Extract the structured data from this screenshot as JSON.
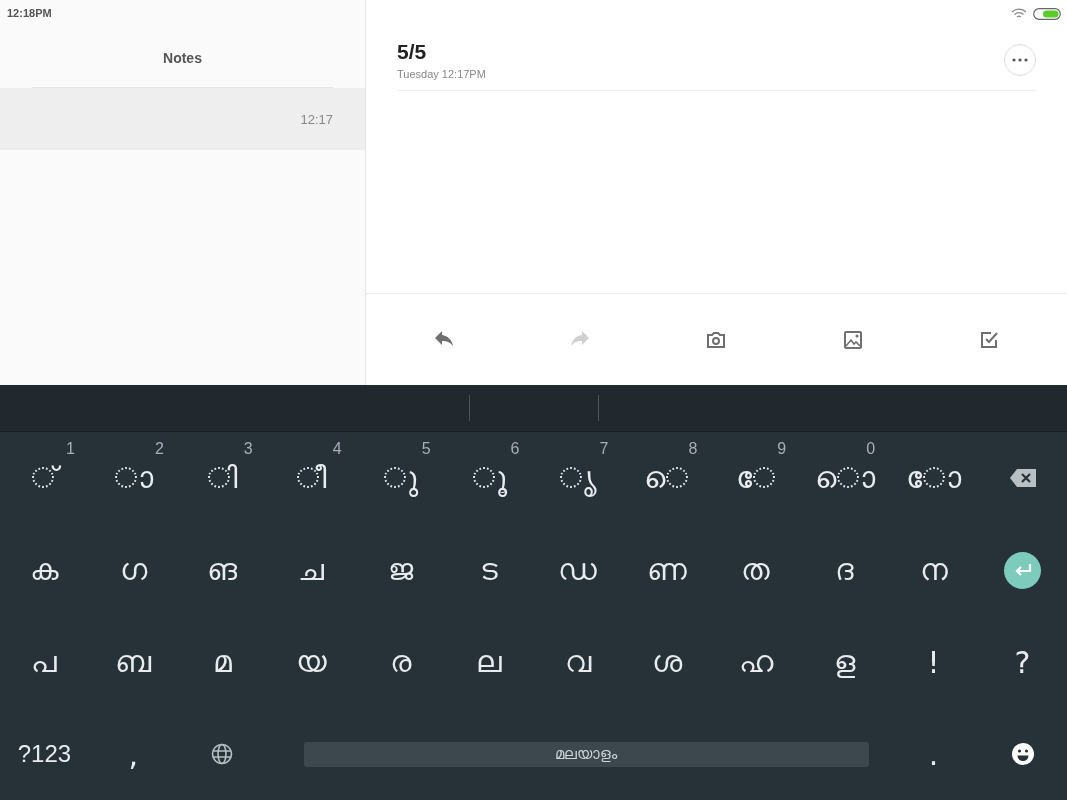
{
  "status_bar": {
    "time": "12:18PM"
  },
  "list_panel": {
    "title": "Notes",
    "notes": [
      {
        "time": "12:17",
        "selected": true
      }
    ]
  },
  "note": {
    "title": "5/5",
    "date": "Tuesday 12:17PM"
  },
  "toolbar": [
    {
      "kind": "undo",
      "disabled": false
    },
    {
      "kind": "redo",
      "disabled": true
    },
    {
      "kind": "camera",
      "disabled": false
    },
    {
      "kind": "image",
      "disabled": false
    },
    {
      "kind": "checklist",
      "disabled": false
    }
  ],
  "keyboard": {
    "rows": [
      [
        {
          "kind": "char",
          "label": "◌്",
          "hint": "1"
        },
        {
          "kind": "char",
          "label": "◌ാ",
          "hint": "2"
        },
        {
          "kind": "char",
          "label": "◌ി",
          "hint": "3"
        },
        {
          "kind": "char",
          "label": "◌ീ",
          "hint": "4"
        },
        {
          "kind": "char",
          "label": "◌ു",
          "hint": "5"
        },
        {
          "kind": "char",
          "label": "◌ൂ",
          "hint": "6"
        },
        {
          "kind": "char",
          "label": "◌ൃ",
          "hint": "7"
        },
        {
          "kind": "char",
          "label": "◌െ",
          "hint": "8"
        },
        {
          "kind": "char",
          "label": "◌േ",
          "hint": "9"
        },
        {
          "kind": "char",
          "label": "◌ൊ",
          "hint": "0"
        },
        {
          "kind": "char",
          "label": "◌ോ"
        },
        {
          "kind": "backspace"
        }
      ],
      [
        {
          "kind": "char",
          "label": "ക"
        },
        {
          "kind": "char",
          "label": "ഗ"
        },
        {
          "kind": "char",
          "label": "ങ"
        },
        {
          "kind": "char",
          "label": "ച"
        },
        {
          "kind": "char",
          "label": "ജ"
        },
        {
          "kind": "char",
          "label": "ട"
        },
        {
          "kind": "char",
          "label": "ഡ"
        },
        {
          "kind": "char",
          "label": "ണ"
        },
        {
          "kind": "char",
          "label": "ത"
        },
        {
          "kind": "char",
          "label": "ദ"
        },
        {
          "kind": "char",
          "label": "ന"
        },
        {
          "kind": "enter"
        }
      ],
      [
        {
          "kind": "char",
          "label": "പ"
        },
        {
          "kind": "char",
          "label": "ബ"
        },
        {
          "kind": "char",
          "label": "മ"
        },
        {
          "kind": "char",
          "label": "യ"
        },
        {
          "kind": "char",
          "label": "ര"
        },
        {
          "kind": "char",
          "label": "ല"
        },
        {
          "kind": "char",
          "label": "വ"
        },
        {
          "kind": "char",
          "label": "ശ"
        },
        {
          "kind": "char",
          "label": "ഹ"
        },
        {
          "kind": "char",
          "label": "ള"
        },
        {
          "kind": "char",
          "label": "!"
        },
        {
          "kind": "char",
          "label": "?"
        }
      ]
    ],
    "bottom_row": [
      {
        "kind": "symbols",
        "label": "?123"
      },
      {
        "kind": "char",
        "label": ","
      },
      {
        "kind": "globe"
      },
      {
        "kind": "space",
        "label": "മലയാളം"
      },
      {
        "kind": "char",
        "label": "."
      },
      {
        "kind": "emoji"
      }
    ]
  }
}
